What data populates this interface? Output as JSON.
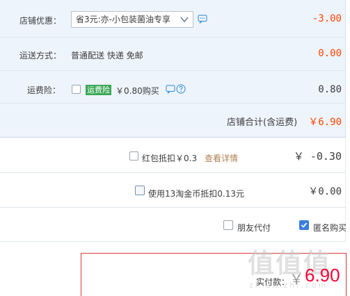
{
  "store_discount": {
    "label": "店铺优惠：",
    "selected": "省3元:亦-小包装菌油专享",
    "amount": "-3.00"
  },
  "shipping": {
    "label": "运送方式：",
    "method": "普通配送 快递 免邮",
    "amount": "0.00"
  },
  "insurance": {
    "label": "运费险：",
    "tag": "运费险",
    "price_text": "￥0.80购买",
    "amount": "0.80",
    "checked": false
  },
  "store_total": {
    "label": "店铺合计(含运费)",
    "amount": "￥6.90"
  },
  "red_packet": {
    "label": "红包抵扣￥0.3",
    "link": "查看详情",
    "amount": "￥ -0.30",
    "checked": false
  },
  "taobao_coins": {
    "label": "使用13淘金币抵扣0.13元",
    "amount": "￥0.00",
    "checked": false
  },
  "options": {
    "friend_pay": {
      "label": "朋友代付",
      "checked": false
    },
    "anonymous": {
      "label": "匿名购买",
      "checked": true
    }
  },
  "actual_payment": {
    "label": "实付款：",
    "currency": "￥",
    "amount": "6.90"
  },
  "watermark": {
    "text": "值值值",
    "sub": "zhizhizhi.com"
  },
  "colors": {
    "accent_red": "#ff4400",
    "brand_blue": "#3b7ddd",
    "insurance_green": "#3aa856"
  }
}
